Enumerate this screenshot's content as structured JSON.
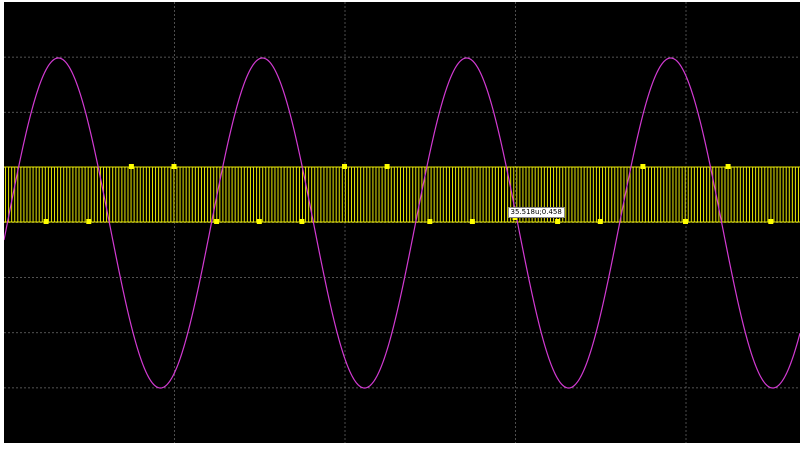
{
  "chart_data": {
    "type": "line",
    "grid": true,
    "divisions": {
      "x": 4.67,
      "y": 8
    },
    "colors": {
      "background": "#000000",
      "grid": "#6e6e6e",
      "sine": "#d23ad2",
      "pwm": "#e6e600",
      "marker": "#ffff00"
    },
    "series": [
      {
        "waveform": "sine",
        "periods_visible": 3.9,
        "amplitude_div": 3,
        "offset_div": 0
      },
      {
        "waveform": "pwm",
        "high_div": 1,
        "low_div": 0,
        "pulses_visible": 260
      }
    ],
    "markers_high_x": [
      0.75,
      1.0,
      2.0,
      2.25,
      3.75,
      4.25
    ],
    "markers_low_x": [
      0.25,
      0.5,
      1.25,
      1.5,
      1.75,
      2.5,
      2.75,
      3.25,
      3.5,
      4.0,
      4.5
    ]
  },
  "cursor_readout": {
    "label": "35.518u;0.458",
    "x_div": 3.0
  }
}
